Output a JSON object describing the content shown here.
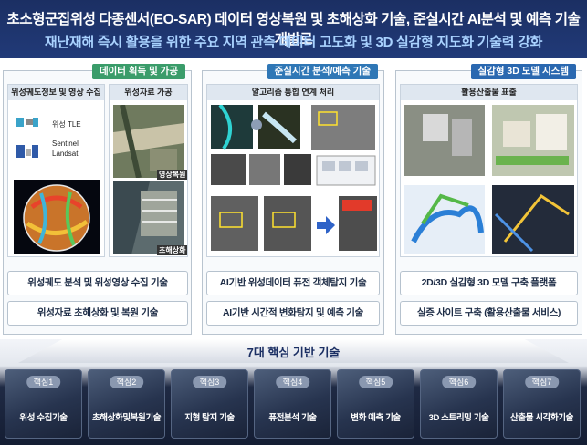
{
  "header": {
    "title_line1": "초소형군집위성 다종센서(EO-SAR) 데이터 영상복원 및 초해상화 기술, 준실시간 AI분석 및 예측 기술 개발로",
    "title_line2": "재난재해 즉시 활용을 위한 주요 지역 관측 데이터 고도화 및 3D 실감형 지도화 기술력 강화"
  },
  "panels": {
    "acquisition": {
      "tag": "데이터 획득 및 가공",
      "sub_left": "위성궤도정보 및 영상 수집",
      "sub_right": "위성자료 가공",
      "tle_label": "위성 TLE",
      "sentinel_label": "Sentinel",
      "landsat_label": "Landsat",
      "img_label1": "영상복원",
      "img_label2": "초해상화",
      "box1": "위성궤도 분석 및 위성영상 수집 기술",
      "box2": "위성자료 초해상화 및 복원 기술"
    },
    "analysis": {
      "tag": "준실시간 분석/예측 기술",
      "sub": "알고리즘 통합 연계 처리",
      "box1": "AI기반 위성데이터 퓨전 객체탐지 기술",
      "box2": "AI기반 시간적 변화탐지 및 예측 기술"
    },
    "model3d": {
      "tag": "실감형 3D 모델 시스템",
      "sub": "활용산출물 표출",
      "box1": "2D/3D 실감형 3D 모델 구축 플랫폼",
      "box2": "실증 사이트 구축 (활용산출물 서비스)"
    }
  },
  "core": {
    "title": "7대 핵심 기반 기술",
    "items": [
      {
        "badge": "핵심1",
        "label": "위성 수집기술"
      },
      {
        "badge": "핵심2",
        "label": "초해상화및복원기술"
      },
      {
        "badge": "핵심3",
        "label": "지형 탐지 기술"
      },
      {
        "badge": "핵심4",
        "label": "퓨전분석 기술"
      },
      {
        "badge": "핵심5",
        "label": "변화 예측 기술"
      },
      {
        "badge": "핵심6",
        "label": "3D 스트리밍 기술"
      },
      {
        "badge": "핵심7",
        "label": "산출물 시각화기술"
      }
    ]
  }
}
